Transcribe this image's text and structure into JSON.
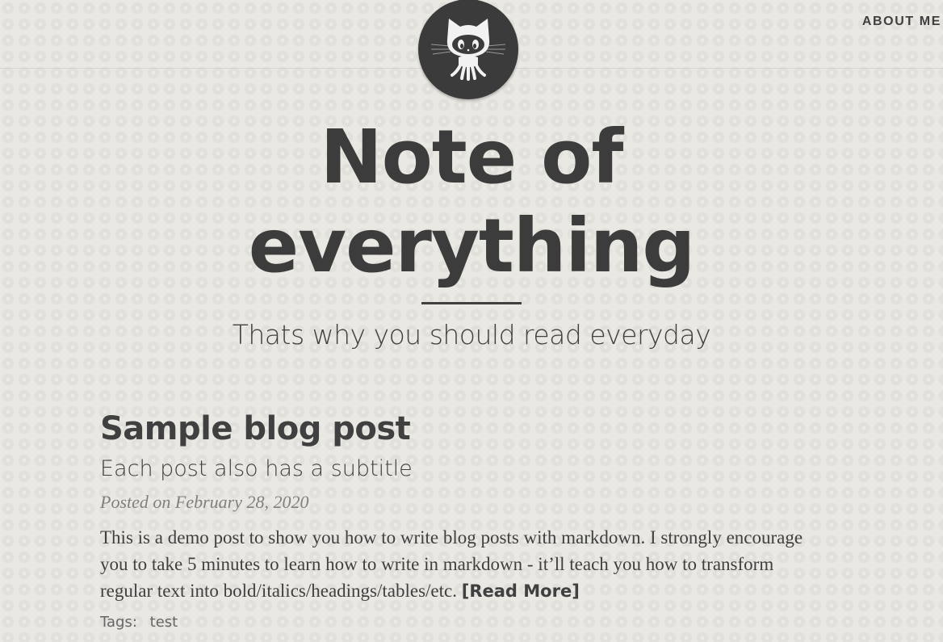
{
  "nav": {
    "about_label": "ABOUT ME"
  },
  "avatar": {
    "icon": "octocat-icon"
  },
  "header": {
    "title": "Note of everything",
    "subtitle": "Thats why you should read everyday"
  },
  "post": {
    "title": "Sample blog post",
    "subtitle": "Each post also has a subtitle",
    "meta": "Posted on February 28, 2020",
    "excerpt": "This is a demo post to show you how to write blog posts with markdown. I strongly encourage you to take 5 minutes to learn how to write in markdown - it’ll teach you how to transform regular text into bold/italics/headings/tables/etc.",
    "read_more": "[Read More]",
    "tags_label": "Tags:",
    "tags": [
      "test"
    ]
  }
}
